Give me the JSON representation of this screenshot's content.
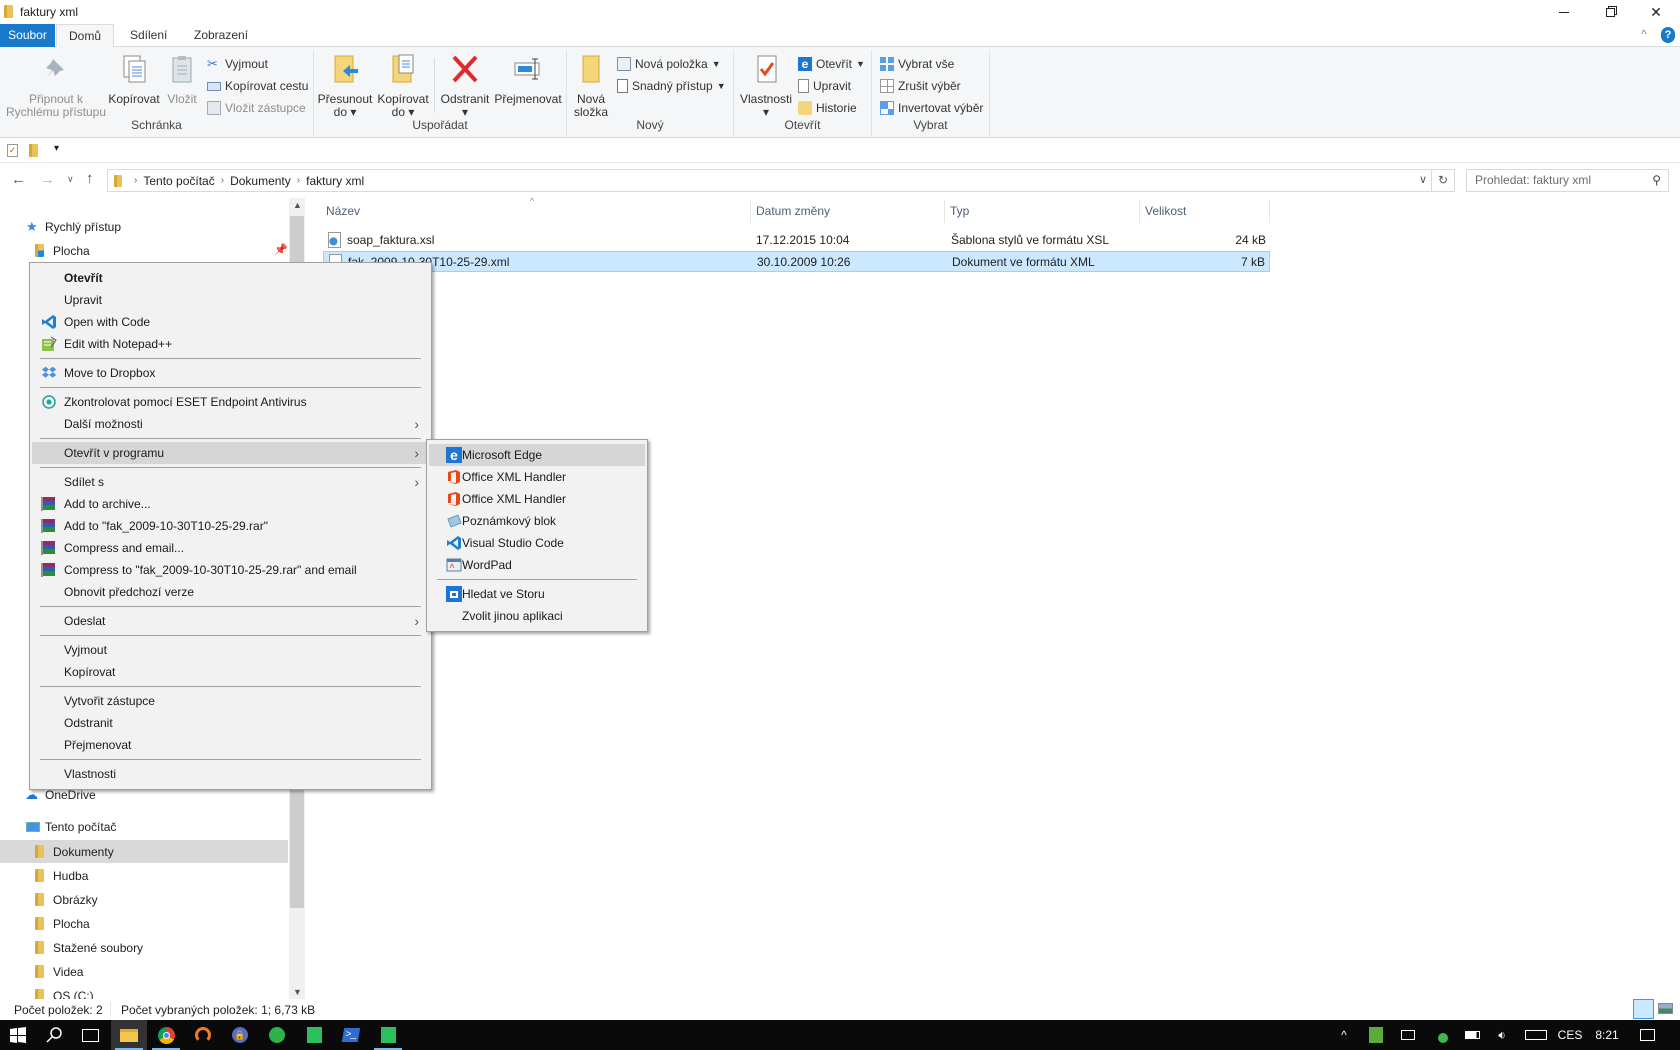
{
  "window": {
    "title": "faktury xml",
    "controls": [
      "minimize-icon",
      "restore-icon",
      "close-icon"
    ]
  },
  "ribbon_tabs": [
    {
      "label": "Soubor",
      "active": false
    },
    {
      "label": "Domů",
      "active": true
    },
    {
      "label": "Sdílení",
      "active": false
    },
    {
      "label": "Zobrazení",
      "active": false
    }
  ],
  "ribbon": {
    "groups": {
      "clipboard": "Schránka",
      "organize": "Uspořádat",
      "new": "Nový",
      "open": "Otevřít",
      "select": "Vybrat"
    },
    "pin": {
      "line1": "Připnout k",
      "line2": "Rychlému přístupu"
    },
    "copy": "Kopírovat",
    "paste": "Vložit",
    "cut": "Vyjmout",
    "copy_path": "Kopírovat cestu",
    "paste_shortcut": "Vložit zástupce",
    "move_to": {
      "line1": "Přesunout",
      "line2": "do"
    },
    "copy_to": {
      "line1": "Kopírovat",
      "line2": "do"
    },
    "delete": "Odstranit",
    "rename": "Přejmenovat",
    "new_folder": {
      "line1": "Nová",
      "line2": "složka"
    },
    "new_item": "Nová položka",
    "easy_access": "Snadný přístup",
    "properties": "Vlastnosti",
    "open": "Otevřít",
    "edit": "Upravit",
    "history": "Historie",
    "select_all": "Vybrat vše",
    "select_none": "Zrušit výběr",
    "invert_selection": "Invertovat výběr"
  },
  "address": {
    "crumbs": [
      "Tento počítač",
      "Dokumenty",
      "faktury xml"
    ],
    "search_placeholder": "Prohledat: faktury xml"
  },
  "nav": {
    "quick_access": "Rychlý přístup",
    "quick_items": [
      {
        "label": "Plocha",
        "pinned": true
      }
    ],
    "onedrive": "OneDrive",
    "this_pc": "Tento počítač",
    "pc_items": [
      {
        "label": "Dokumenty",
        "selected": true
      },
      {
        "label": "Hudba"
      },
      {
        "label": "Obrázky"
      },
      {
        "label": "Plocha"
      },
      {
        "label": "Stažené soubory"
      },
      {
        "label": "Videa"
      },
      {
        "label": "OS (C:)"
      }
    ]
  },
  "files": {
    "columns": [
      "Název",
      "Datum změny",
      "Typ",
      "Velikost"
    ],
    "rows": [
      {
        "name": "soap_faktura.xsl",
        "date": "17.12.2015 10:04",
        "type": "Šablona stylů ve formátu XSL",
        "size": "24 kB",
        "selected": false
      },
      {
        "name": "fak_2009-10-30T10-25-29.xml",
        "date": "30.10.2009 10:26",
        "type": "Dokument ve formátu XML",
        "size": "7 kB",
        "selected": true
      }
    ]
  },
  "context_menu": [
    {
      "label": "Otevřít",
      "bold": true
    },
    {
      "label": "Upravit"
    },
    {
      "label": "Open with Code",
      "icon": "vscode-icon"
    },
    {
      "label": "Edit with Notepad++",
      "icon": "notepadpp-icon"
    },
    {
      "sep": true
    },
    {
      "label": "Move to Dropbox",
      "icon": "dropbox-icon"
    },
    {
      "sep": true
    },
    {
      "label": "Zkontrolovat pomocí ESET Endpoint Antivirus",
      "icon": "eset-icon"
    },
    {
      "label": "Další možnosti",
      "submenu": true
    },
    {
      "sep": true
    },
    {
      "label": "Otevřít v programu",
      "submenu": true,
      "highlighted": true
    },
    {
      "sep": true
    },
    {
      "label": "Sdílet s",
      "submenu": true
    },
    {
      "label": "Add to archive...",
      "icon": "winrar-icon"
    },
    {
      "label": "Add to \"fak_2009-10-30T10-25-29.rar\"",
      "icon": "winrar-icon"
    },
    {
      "label": "Compress and email...",
      "icon": "winrar-icon"
    },
    {
      "label": "Compress to \"fak_2009-10-30T10-25-29.rar\" and email",
      "icon": "winrar-icon"
    },
    {
      "label": "Obnovit předchozí verze"
    },
    {
      "sep": true
    },
    {
      "label": "Odeslat",
      "submenu": true
    },
    {
      "sep": true
    },
    {
      "label": "Vyjmout"
    },
    {
      "label": "Kopírovat"
    },
    {
      "sep": true
    },
    {
      "label": "Vytvořit zástupce"
    },
    {
      "label": "Odstranit"
    },
    {
      "label": "Přejmenovat"
    },
    {
      "sep": true
    },
    {
      "label": "Vlastnosti"
    }
  ],
  "open_with_menu": [
    {
      "label": "Microsoft Edge",
      "icon": "edge-icon",
      "highlighted": true
    },
    {
      "label": "Office XML Handler",
      "icon": "office-icon"
    },
    {
      "label": "Office XML Handler",
      "icon": "office-icon"
    },
    {
      "label": "Poznámkový blok",
      "icon": "notepad-icon"
    },
    {
      "label": "Visual Studio Code",
      "icon": "vscode-icon"
    },
    {
      "label": "WordPad",
      "icon": "wordpad-icon"
    },
    {
      "sep": true
    },
    {
      "label": "Hledat ve Storu",
      "icon": "store-icon"
    },
    {
      "label": "Zvolit jinou aplikaci"
    }
  ],
  "status": {
    "count": "Počet položek: 2",
    "selected": "Počet vybraných položek: 1; 6,73 kB"
  },
  "taskbar": {
    "apps": [
      "start-icon",
      "search-icon",
      "task-view-icon",
      "file-explorer-icon",
      "chrome-icon",
      "avast-icon",
      "keepass-icon",
      "hangouts-icon",
      "evernote-icon",
      "powershell-icon",
      "evernote-icon"
    ],
    "language": "CES",
    "time": "8:21"
  },
  "colors": {
    "accent": "#1979ca",
    "selection": "#cce8ff",
    "menu_bg": "#f2f2f2"
  }
}
